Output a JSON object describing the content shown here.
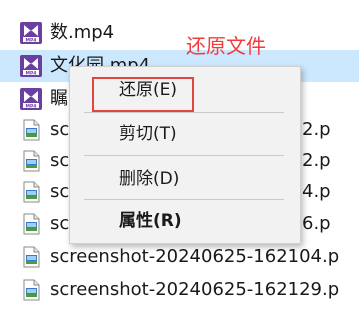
{
  "files": [
    {
      "name": "数.mp4",
      "type": "mp4",
      "selected": false
    },
    {
      "name": "文化园.mp4",
      "type": "mp4",
      "selected": true
    },
    {
      "name": "瞩",
      "type": "mp4",
      "selected": false
    },
    {
      "name": "sc",
      "type": "screenshot",
      "selected": false,
      "suffix": "2.p"
    },
    {
      "name": "sc",
      "type": "screenshot",
      "selected": false,
      "suffix": "2.p"
    },
    {
      "name": "sc",
      "type": "screenshot",
      "selected": false,
      "suffix": "4.p"
    },
    {
      "name": "sc",
      "type": "screenshot",
      "selected": false,
      "suffix": "6.p"
    },
    {
      "name": "screenshot-20240625-162104.p",
      "type": "screenshot",
      "selected": false
    },
    {
      "name": "screenshot-20240625-162129.p",
      "type": "screenshot",
      "selected": false
    }
  ],
  "annotation": "还原文件",
  "context_menu": {
    "restore": "还原(E)",
    "cut": "剪切(T)",
    "delete": "删除(D)",
    "properties": "属性(R)"
  },
  "colors": {
    "selection": "#cce8ff",
    "annotation": "#f03c3c",
    "highlight_box": "#e0463d",
    "mp4_icon": "#6b3fa0"
  }
}
